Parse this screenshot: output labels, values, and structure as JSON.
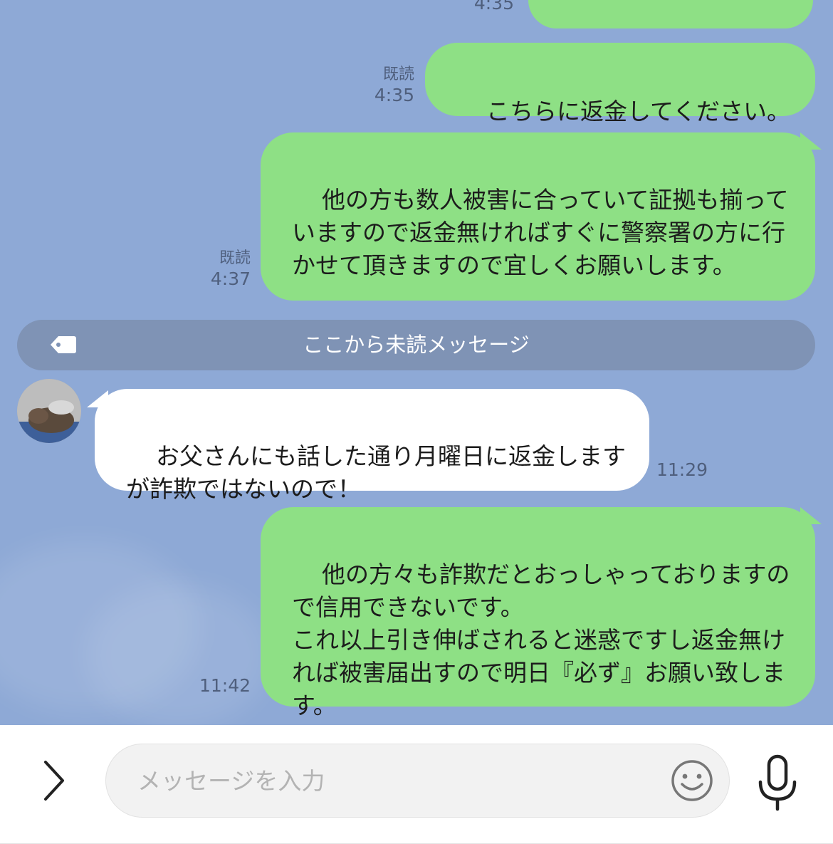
{
  "messages": [
    {
      "side": "out",
      "text": "こちらに返金してください。",
      "read": "既読",
      "time": "4:35"
    },
    {
      "side": "out",
      "text": "他の方も数人被害に合っていて証拠も揃っていますので返金無ければすぐに警察署の方に行かせて頂きますので宜しくお願いします。",
      "read": "既読",
      "time": "4:37"
    },
    {
      "side": "in",
      "text": "お父さんにも話した通り月曜日に返金しますが詐欺ではないので！",
      "time": "11:29"
    },
    {
      "side": "out",
      "text": "他の方々も詐欺だとおっしゃっておりますので信用できないです。\nこれ以上引き伸ばされると迷惑ですし返金無ければ被害届出すので明日『必ず』お願い致します。",
      "time": "11:42"
    }
  ],
  "top_partial_time": "4:35",
  "unread_divider": "ここから未読メッセージ",
  "input": {
    "placeholder": "メッセージを入力"
  },
  "icons": {
    "expand": "chevron-right-icon",
    "emoji": "emoji-icon",
    "mic": "microphone-icon",
    "divider": "tag-icon"
  },
  "colors": {
    "background": "#8ea9d6",
    "outgoing_bubble": "#8ee085",
    "incoming_bubble": "#ffffff",
    "divider": "#7f93b5"
  }
}
